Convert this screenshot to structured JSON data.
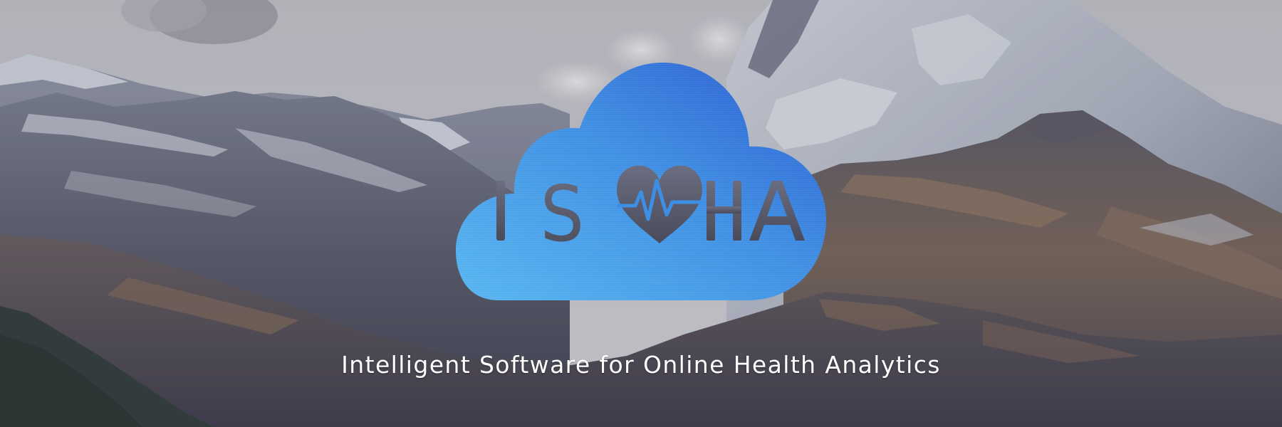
{
  "brand": {
    "logo_text": "ISOHA",
    "tagline": "Intelligent Software for Online Health Analytics",
    "accent_start": "#52b1ef",
    "accent_end": "#2a5fd2"
  },
  "icons": {
    "logo": "cloud-heart-logo-icon",
    "heart": "heart-pulse-icon"
  },
  "background": {
    "scene": "mountain-landscape",
    "sky": "#d2d1d5",
    "snow": "#e9ecf2",
    "rock_dark": "#4e5366",
    "rock_brown": "#7a6554"
  }
}
